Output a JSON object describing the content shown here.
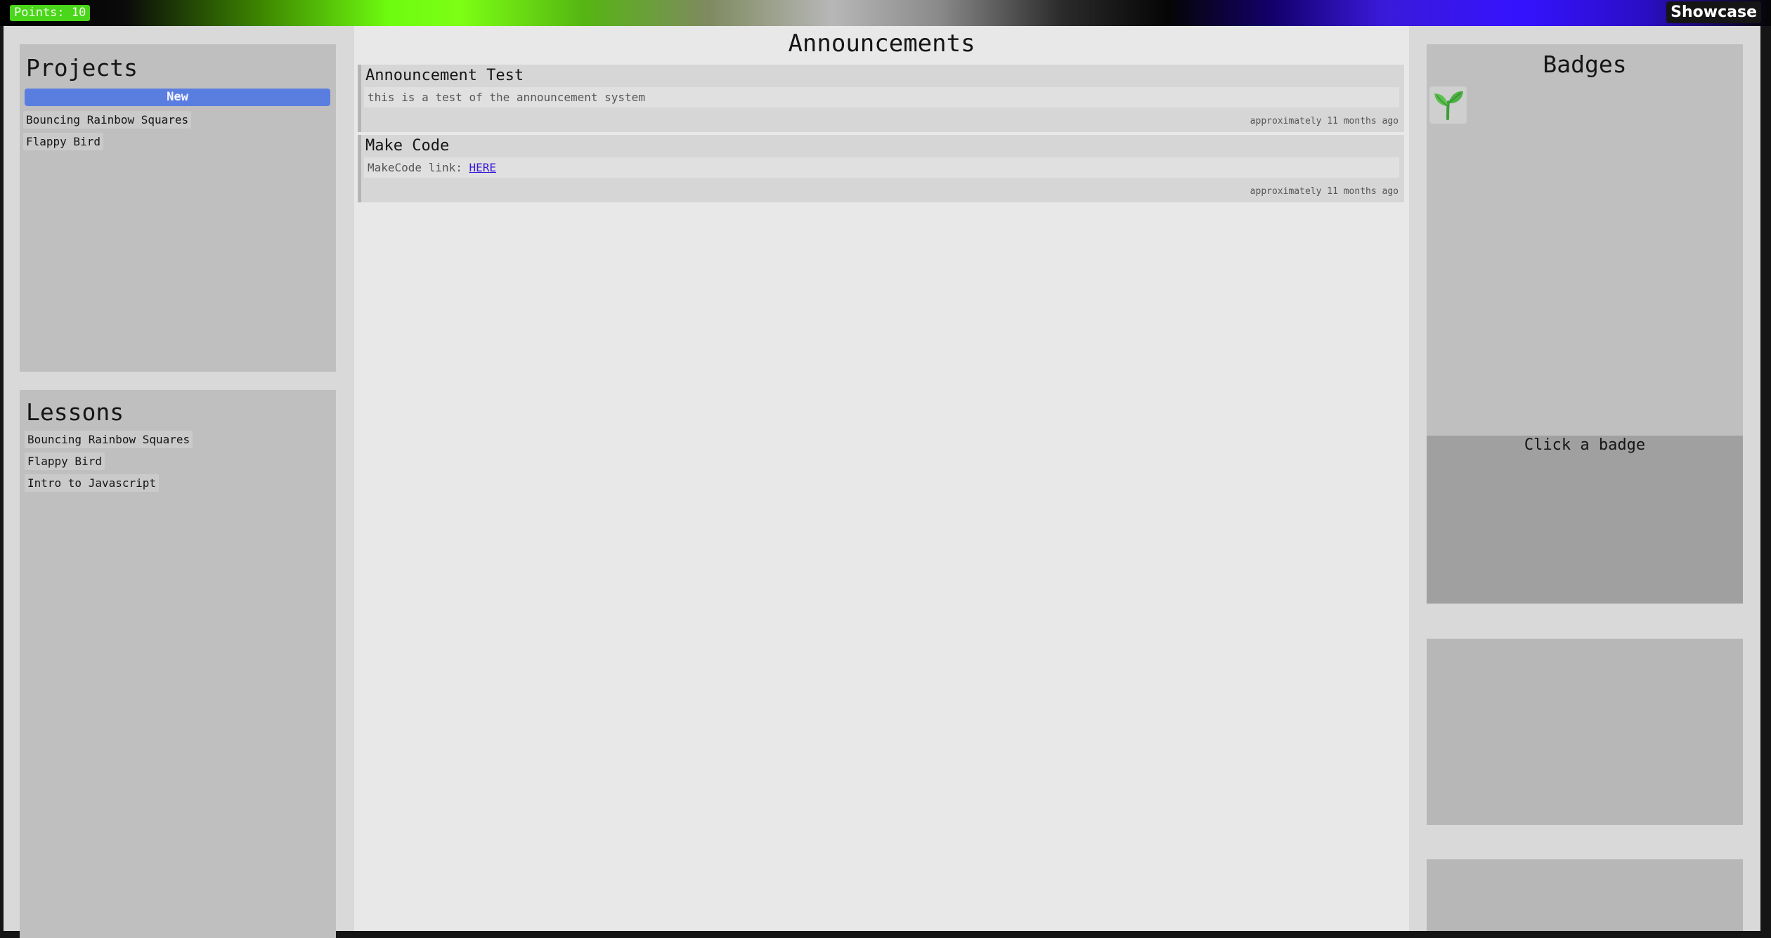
{
  "header": {
    "points_label": "Points: 10",
    "showcase_label": "Showcase"
  },
  "projects": {
    "title": "Projects",
    "new_label": "New",
    "items": [
      {
        "label": "Bouncing Rainbow Squares"
      },
      {
        "label": "Flappy Bird"
      }
    ]
  },
  "lessons": {
    "title": "Lessons",
    "items": [
      {
        "label": "Bouncing Rainbow Squares"
      },
      {
        "label": "Flappy Bird"
      },
      {
        "label": "Intro to Javascript"
      }
    ]
  },
  "announcements": {
    "title": "Announcements",
    "items": [
      {
        "title": "Announcement Test",
        "body": "this is a test of the announcement system",
        "time": "approximately 11 months ago"
      },
      {
        "title": "Make Code",
        "body_prefix": "MakeCode link: ",
        "link_label": "HERE",
        "time": "approximately 11 months ago"
      }
    ]
  },
  "badges": {
    "title": "Badges",
    "hint": "Click a badge",
    "items": [
      {
        "icon": "seedling-icon"
      }
    ]
  },
  "colors": {
    "points_badge": "#4ad61a",
    "new_button": "#5a7de0",
    "link": "#3418d8"
  }
}
